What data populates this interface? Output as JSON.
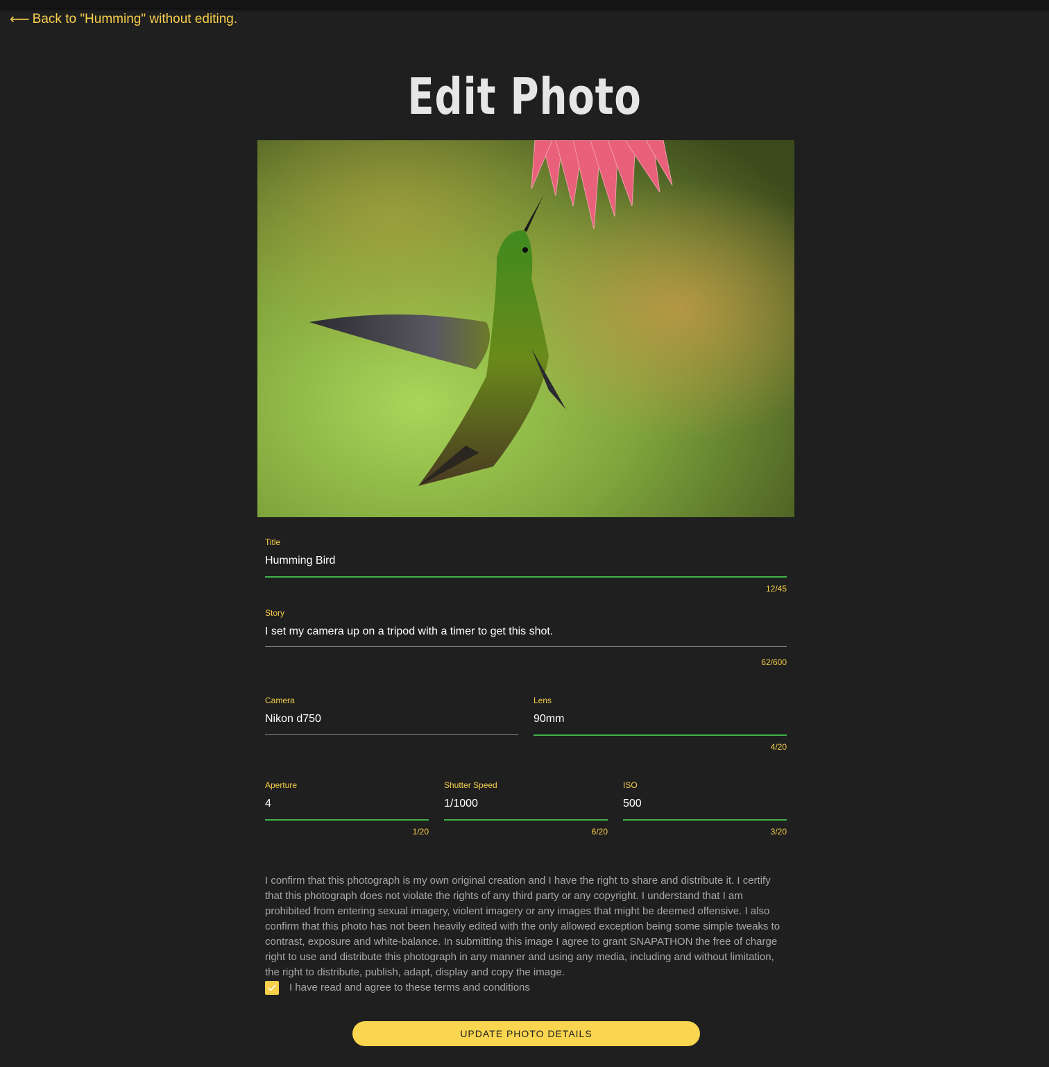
{
  "nav": {
    "back_label": "Back to \"Humming\" without editing."
  },
  "page": {
    "title": "Edit Photo"
  },
  "form": {
    "title": {
      "label": "Title",
      "value": "Humming Bird",
      "counter": "12/45"
    },
    "story": {
      "label": "Story",
      "value": "I set my camera up on a tripod with a timer to get this shot.",
      "counter": "62/600"
    },
    "camera": {
      "label": "Camera",
      "value": "Nikon d750"
    },
    "lens": {
      "label": "Lens",
      "value": "90mm",
      "counter": "4/20"
    },
    "aperture": {
      "label": "Aperture",
      "value": "4",
      "counter": "1/20"
    },
    "shutter_speed": {
      "label": "Shutter Speed",
      "value": "1/1000",
      "counter": "6/20"
    },
    "iso": {
      "label": "ISO",
      "value": "500",
      "counter": "3/20"
    },
    "terms_text": "I confirm that this photograph is my own original creation and I have the right to share and distribute it. I certify that this photograph does not violate the rights of any third party or any copyright. I understand that I am prohibited from entering sexual imagery, violent imagery or any images that might be deemed offensive. I also confirm that this photo has not been heavily edited with the only allowed exception being some simple tweaks to contrast, exposure and white-balance. In submitting this image I agree to grant SNAPATHON the free of charge right to use and distribute this photograph in any manner and using any media, including and without limitation, the right to distribute, publish, adapt, display and copy the image.",
    "agree_label": "I have read and agree to these terms and conditions",
    "agree_checked": true,
    "submit_label": "UPDATE PHOTO DETAILS"
  },
  "colors": {
    "background": "#1f1f1f",
    "accent": "#f7cf4a",
    "active_underline": "#3eb34a"
  },
  "icons": {
    "back": "arrow-left-icon",
    "checkbox": "check-icon"
  }
}
